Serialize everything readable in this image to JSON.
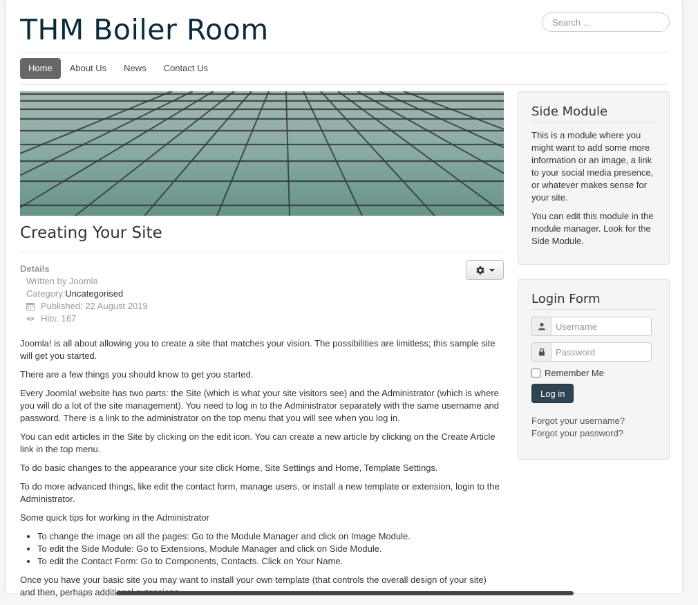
{
  "site": {
    "title": "THM Boiler Room"
  },
  "search": {
    "placeholder": "Search ..."
  },
  "nav": {
    "items": [
      {
        "label": "Home",
        "active": true
      },
      {
        "label": "About Us"
      },
      {
        "label": "News"
      },
      {
        "label": "Contact Us"
      }
    ]
  },
  "article": {
    "title": "Creating Your Site",
    "details": {
      "heading": "Details",
      "written_by": "Written by Joomla",
      "category_label": "Category: ",
      "category_value": "Uncategorised",
      "published": "Published: 22 August 2019",
      "hits": "Hits: 167"
    },
    "paragraphs": [
      "Joomla! is all about allowing you to create a site that matches your vision. The possibilities are limitless; this sample site will get you started.",
      "There are a few things you should know to get you started.",
      "Every Joomla! website has two parts: the Site (which is what your site visitors see) and the Administrator (which is where you will do a lot of the site management). You need to log in to the Administrator separately with the same username and password. There is a link to the administrator on the top menu that you will see when you log in.",
      "You can edit articles in the Site by clicking on the edit icon. You can create a new article by clicking on the Create Article link in the top menu.",
      "To do basic changes to the appearance your site click Home, Site Settings and Home, Template Settings.",
      "To do more advanced things, like edit the contact form, manage users, or install a new template or extension, login to the Administrator.",
      "Some quick tips for working in the Administrator"
    ],
    "tips": [
      "To change the image on all the pages: Go to the Module Manager and click on Image Module.",
      "To edit the Side Module: Go to Extensions, Module Manager and click on Side Module.",
      "To edit the Contact Form: Go to Components, Contacts. Click on Your Name."
    ],
    "closing": "Once you have your basic site you may want to install your own template (that controls the overall design of your site) and then, perhaps additional extensions."
  },
  "side_module": {
    "title": "Side Module",
    "p1": "This is a module where you might want to add some more information or an image, a link to your social media presence, or whatever makes sense for your site.",
    "p2": "You can edit this module in the module manager. Look for the Side Module."
  },
  "login": {
    "title": "Login Form",
    "username_placeholder": "Username",
    "password_placeholder": "Password",
    "remember": "Remember Me",
    "button": "Log in",
    "forgot_username": "Forgot your username?",
    "forgot_password": "Forgot your password?"
  }
}
